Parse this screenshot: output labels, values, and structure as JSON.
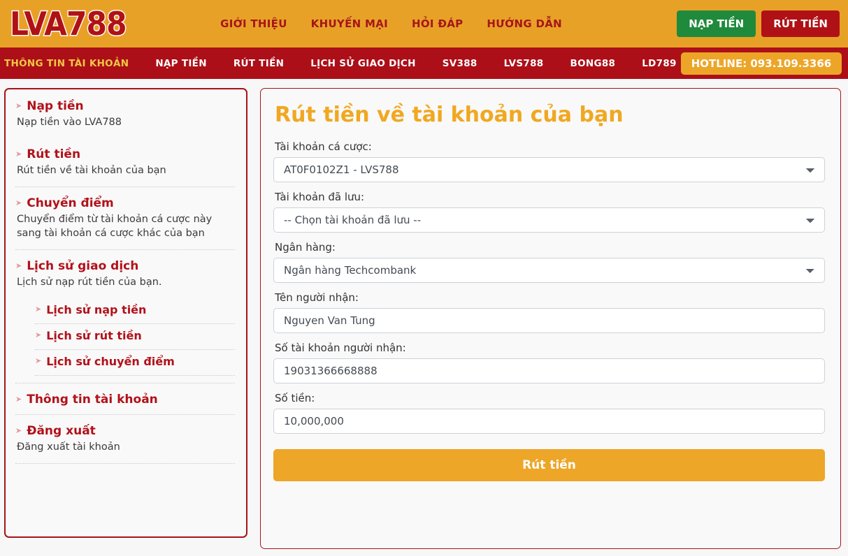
{
  "brand": {
    "logo_text": "LVA788",
    "logo_color": "#b01116",
    "header_bg": "#e8a127"
  },
  "header": {
    "nav": [
      {
        "label": "GIỚI THIỆU"
      },
      {
        "label": "KHUYẾN MẠI"
      },
      {
        "label": "HỎI ĐÁP"
      },
      {
        "label": "HƯỚNG DẪN"
      }
    ],
    "deposit_button": "NẠP TIỀN",
    "withdraw_button": "RÚT TIỀN",
    "deposit_color": "#1f8a3b",
    "withdraw_color": "#b01116"
  },
  "subnav": {
    "items": [
      {
        "label": "THÔNG TIN TÀI KHOẢN",
        "active": true
      },
      {
        "label": "NẠP TIỀN",
        "active": false
      },
      {
        "label": "RÚT TIỀN",
        "active": false
      },
      {
        "label": "LỊCH SỬ GIAO DỊCH",
        "active": false
      },
      {
        "label": "SV388",
        "active": false
      },
      {
        "label": "LVS788",
        "active": false
      },
      {
        "label": "BONG88",
        "active": false
      },
      {
        "label": "LD789",
        "active": false
      }
    ],
    "hotline": "HOTLINE: 093.109.3366",
    "bar_color": "#ac0f18",
    "active_color": "#f2c744",
    "hotline_bg": "#eda528"
  },
  "sidebar": {
    "blocks": [
      {
        "title": "Nạp tiền",
        "desc": "Nạp tiền vào LVA788"
      },
      {
        "title": "Rút tiền",
        "desc": "Rút tiền về tài khoản của bạn"
      },
      {
        "title": "Chuyển điểm",
        "desc": "Chuyển điểm từ tài khoản cá cược này sang tài khoản cá cược khác của bạn"
      }
    ],
    "history": {
      "title": "Lịch sử giao dịch",
      "desc": "Lịch sử nạp rút tiền của bạn.",
      "sub_items": [
        {
          "label": "Lịch sử nạp tiền"
        },
        {
          "label": "Lịch sử rút tiền"
        },
        {
          "label": "Lịch sử chuyển điểm"
        }
      ]
    },
    "account_info": {
      "title": "Thông tin tài khoản"
    },
    "logout": {
      "title": "Đăng xuất",
      "desc": "Đăng xuất tài khoản"
    },
    "arrow_glyph": "➤",
    "accent_color": "#b2111a"
  },
  "form": {
    "title": "Rút tiền về tài khoản của bạn",
    "title_color": "#f0a821",
    "fields": [
      {
        "label": "Tài khoản cá cược:",
        "type": "select",
        "value": "AT0F0102Z1 - LVS788",
        "name": "betting-account-select"
      },
      {
        "label": "Tài khoản đã lưu:",
        "type": "select",
        "value": "-- Chọn tài khoản đã lưu --",
        "name": "saved-account-select"
      },
      {
        "label": "Ngân hàng:",
        "type": "select",
        "value": "Ngân hàng Techcombank",
        "name": "bank-select"
      },
      {
        "label": "Tên người nhận:",
        "type": "text",
        "value": "Nguyen Van Tung",
        "name": "recipient-name-input"
      },
      {
        "label": "Số tài khoản người nhận:",
        "type": "text",
        "value": "19031366668888",
        "name": "recipient-account-input"
      },
      {
        "label": "Số tiền:",
        "type": "text",
        "value": "10,000,000",
        "name": "amount-input"
      }
    ],
    "submit_label": "Rút tiền",
    "submit_color": "#eda628"
  }
}
